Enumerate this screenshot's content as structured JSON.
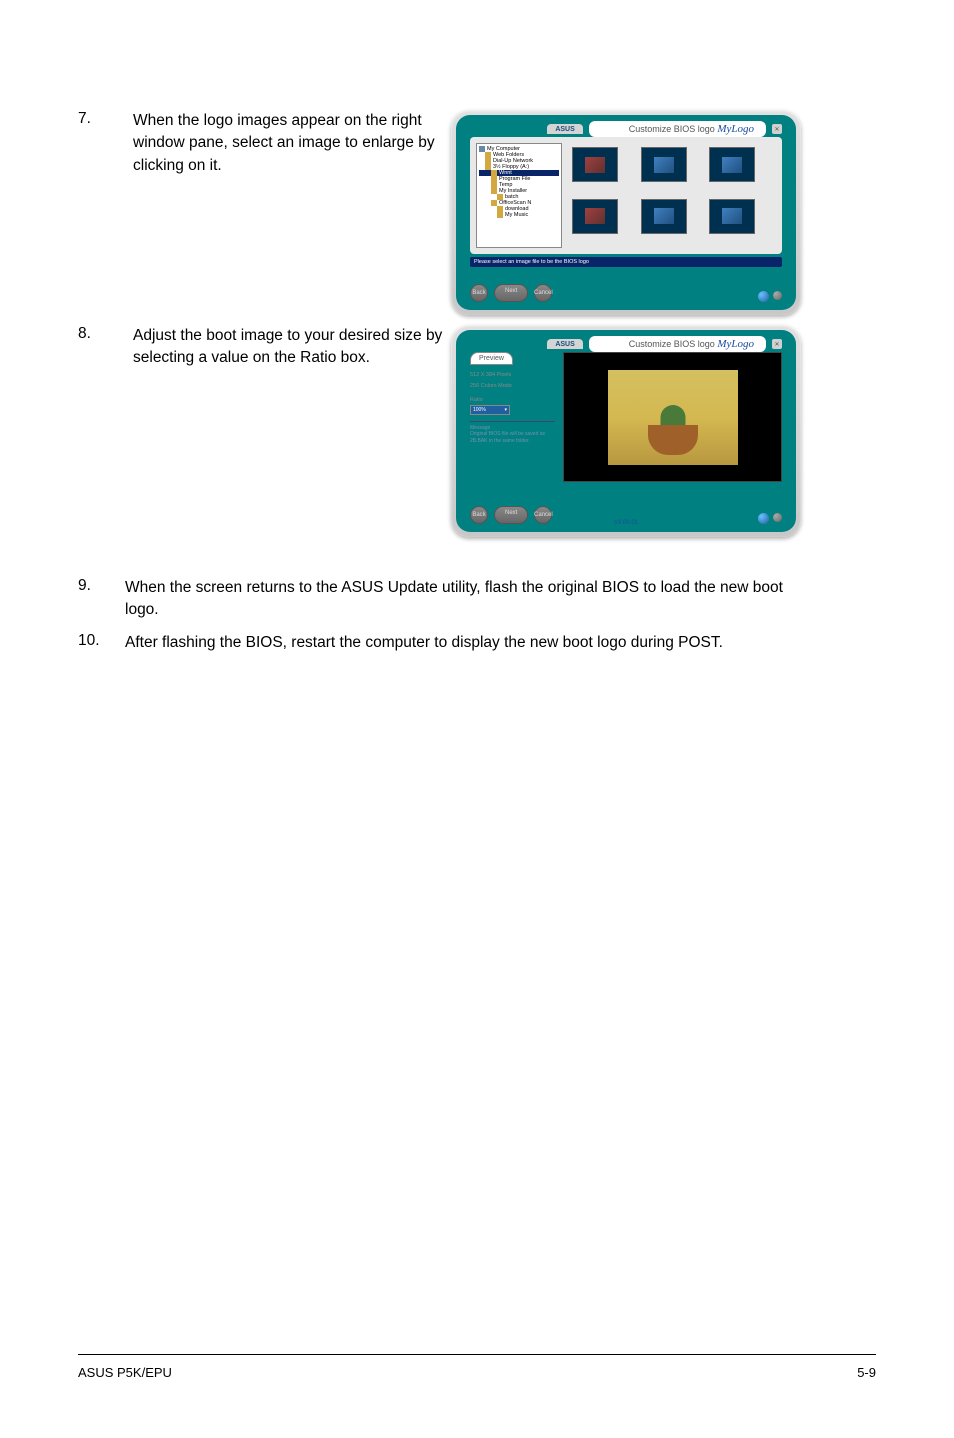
{
  "steps": {
    "s7": {
      "num": "7.",
      "text": "When the logo images appear on the right window pane, select an image to enlarge by clicking on it."
    },
    "s8": {
      "num": "8.",
      "text": "Adjust the boot image to your desired size by selecting a value on the Ratio box."
    },
    "s9": {
      "num": "9.",
      "text": "When the screen returns to the ASUS Update utility, flash the original BIOS to load the new boot logo."
    },
    "s10": {
      "num": "10.",
      "text": "After flashing the BIOS, restart the computer to display the new boot logo during POST."
    }
  },
  "app1": {
    "asus_label": "ASUS",
    "mylogo_prefix": "Customize BIOS logo",
    "mylogo": "MyLogo",
    "close": "✕",
    "tree": {
      "my_computer": "My Computer",
      "web_folders": "Web Folders",
      "dial_up": "Dial-Up Network",
      "floppy": "3½ Floppy (A:)",
      "wnnt": "Wnnt",
      "program_files": "Program File",
      "temp": "Temp",
      "my_install": "My Installer",
      "batch": "batch",
      "office": "OfficeScan N",
      "download": "download",
      "my_music": "My Music"
    },
    "status": "Please select an image file to be the BIOS logo",
    "nav_back": "Back",
    "nav_next": "Next",
    "nav_cancel": "Cancel"
  },
  "app2": {
    "preview_tab": "Preview",
    "resolution": "512 X 384 Pixels",
    "color_mode": "256 Colors Mode",
    "ratio_label": "Ratio",
    "ratio_value": "100%",
    "message_title": "Message",
    "message_body": "Original BIOS file will be saved as 2B.BAK in the same folder.",
    "version": "V3.00.01"
  },
  "footer": {
    "left": "ASUS P5K/EPU",
    "right": "5-9"
  }
}
